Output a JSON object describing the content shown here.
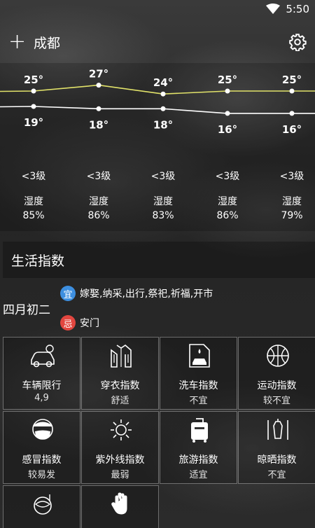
{
  "status": {
    "time": "5:50"
  },
  "header": {
    "add_label": "+",
    "city": "成都"
  },
  "forecast": {
    "highs": [
      "25°",
      "27°",
      "24°",
      "25°",
      "25°"
    ],
    "lows": [
      "19°",
      "18°",
      "18°",
      "16°",
      "16°"
    ],
    "high_values": [
      25,
      27,
      24,
      25,
      25
    ],
    "low_values": [
      19,
      18,
      18,
      16,
      16
    ],
    "wind": [
      "<3级",
      "<3级",
      "<3级",
      "<3级",
      "<3级"
    ],
    "humidity_label": [
      "湿度",
      "湿度",
      "湿度",
      "湿度",
      "湿度"
    ],
    "humidity": [
      "85%",
      "86%",
      "83%",
      "86%",
      "79%"
    ],
    "high_color": "#e2e36a",
    "low_color": "#ffffff"
  },
  "life": {
    "title": "生活指数",
    "lunar_date": "四月初二",
    "good_badge": "宜",
    "good_text": "嫁娶,纳采,出行,祭祀,祈福,开市",
    "good_color": "#3d8fe0",
    "bad_badge": "忌",
    "bad_text": "安门",
    "bad_color": "#e2463f",
    "items": [
      {
        "name": "车辆限行",
        "value": "4,9",
        "icon": "car-icon"
      },
      {
        "name": "穿衣指数",
        "value": "舒适",
        "icon": "jacket-icon"
      },
      {
        "name": "洗车指数",
        "value": "不宜",
        "icon": "carwash-icon"
      },
      {
        "name": "运动指数",
        "value": "较不宜",
        "icon": "basketball-icon"
      },
      {
        "name": "感冒指数",
        "value": "较易发",
        "icon": "mask-icon"
      },
      {
        "name": "紫外线指数",
        "value": "最弱",
        "icon": "sun-icon"
      },
      {
        "name": "旅游指数",
        "value": "适宜",
        "icon": "luggage-icon"
      },
      {
        "name": "晾晒指数",
        "value": "不宜",
        "icon": "drying-icon"
      },
      {
        "name": "",
        "value": "",
        "icon": "fishing-icon"
      },
      {
        "name": "",
        "value": "",
        "icon": "hand-icon"
      }
    ]
  }
}
